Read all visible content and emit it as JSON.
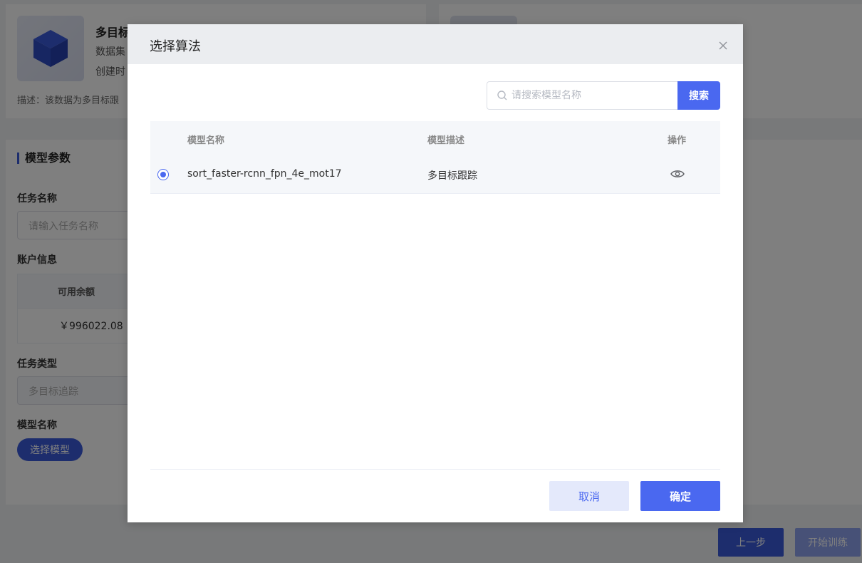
{
  "background": {
    "dataset": {
      "title": "多目标",
      "meta_line1": "数据集",
      "meta_line2": "创建时",
      "description": "描述：该数据为多目标跟"
    },
    "params_section": {
      "title": "模型参数",
      "task_name_label": "任务名称",
      "task_name_placeholder": "请输入任务名称",
      "account_label": "账户信息",
      "balance_header": "可用余额",
      "balance_value": "￥996022.08",
      "task_type_label": "任务类型",
      "task_type_value": "多目标追踪",
      "model_name_label": "模型名称",
      "select_model_button": "选择模型"
    },
    "footer": {
      "prev_button": "上一步",
      "train_button": "开始训练"
    }
  },
  "dialog": {
    "title": "选择算法",
    "close_icon": "close-icon",
    "search": {
      "placeholder": "请搜索模型名称",
      "button": "搜索"
    },
    "table": {
      "columns": [
        "模型名称",
        "模型描述",
        "操作"
      ],
      "rows": [
        {
          "selected": true,
          "name": "sort_faster-rcnn_fpn_4e_mot17",
          "description": "多目标跟踪",
          "action_icon": "eye-icon"
        }
      ]
    },
    "footer": {
      "cancel_button": "取消",
      "confirm_button": "确定"
    }
  },
  "colors": {
    "accent": "#4a68f0",
    "overlay": "rgba(0,0,0,0.5)"
  }
}
